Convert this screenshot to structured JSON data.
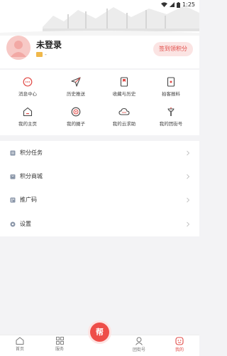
{
  "status_bar": {
    "time": "1:25"
  },
  "profile": {
    "name": "未登录",
    "sub_text": "-",
    "signin_label": "签到领积分"
  },
  "grid": {
    "items": [
      {
        "label": "消息中心",
        "icon": "message-icon"
      },
      {
        "label": "历史推送",
        "icon": "send-icon"
      },
      {
        "label": "收藏与历史",
        "icon": "bookmark-icon"
      },
      {
        "label": "拍客报料",
        "icon": "camera-card-icon"
      },
      {
        "label": "我的主页",
        "icon": "home-page-icon"
      },
      {
        "label": "我的圈子",
        "icon": "circle-icon"
      },
      {
        "label": "我的云求助",
        "icon": "cloud-icon"
      },
      {
        "label": "我的团街号",
        "icon": "torch-icon"
      }
    ]
  },
  "list": {
    "items": [
      {
        "label": "积分任务",
        "icon": "task-icon"
      },
      {
        "label": "积分商城",
        "icon": "mall-icon"
      },
      {
        "label": "推广码",
        "icon": "promo-code-icon"
      },
      {
        "label": "设置",
        "icon": "settings-icon"
      }
    ]
  },
  "bottom_nav": {
    "items": [
      {
        "label": "首页",
        "icon": "home-icon",
        "active": false
      },
      {
        "label": "服务",
        "icon": "services-icon",
        "active": false
      },
      {
        "label": "帮",
        "icon": "help-icon",
        "active": false
      },
      {
        "label": "团街号",
        "icon": "team-icon",
        "active": false
      },
      {
        "label": "我的",
        "icon": "mine-icon",
        "active": true
      }
    ]
  },
  "colors": {
    "accent": "#e14a46",
    "accent_light": "#fbe4e3",
    "background": "#f3f3f5"
  }
}
